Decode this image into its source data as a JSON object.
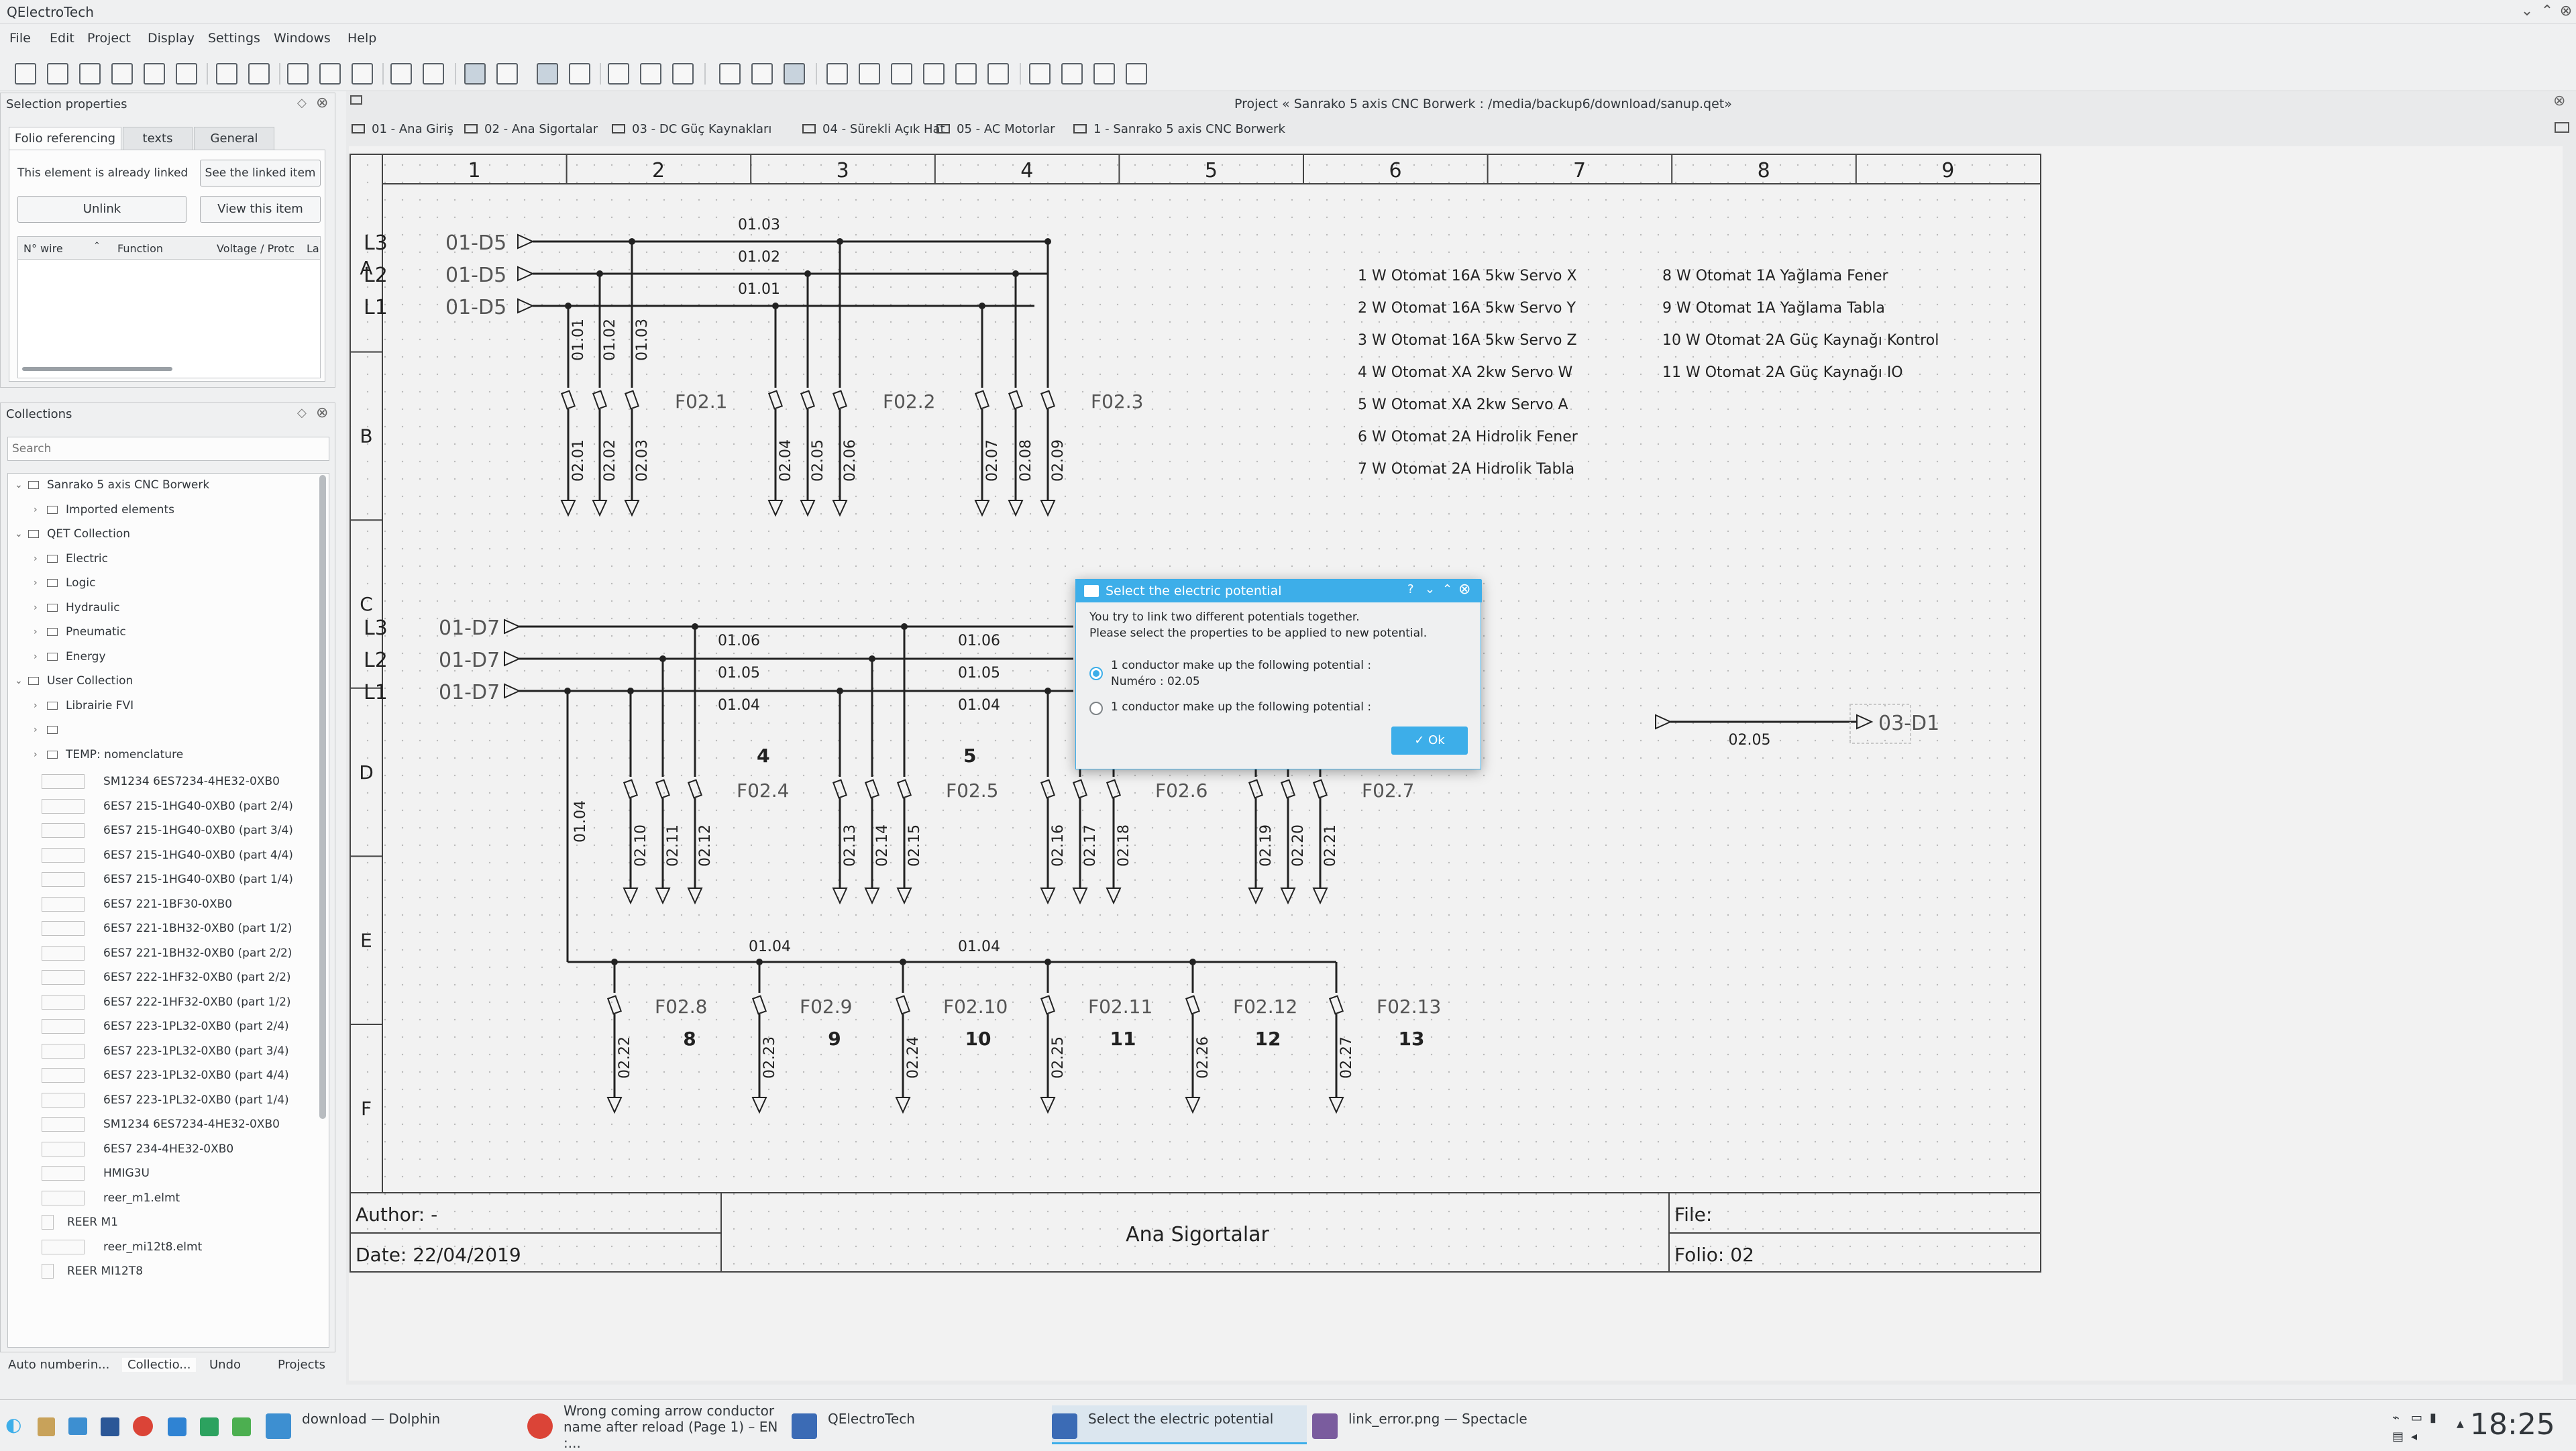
{
  "window": {
    "title": "QElectroTech"
  },
  "menu": [
    "File",
    "Edit",
    "Project",
    "Display",
    "Settings",
    "Windows",
    "Help"
  ],
  "selection_properties": {
    "title": "Selection properties",
    "tabs": [
      "Folio referencing",
      "texts",
      "General"
    ],
    "linked_msg": "This element is already linked",
    "see_linked": "See the linked item",
    "unlink": "Unlink",
    "view_item": "View this item",
    "columns": [
      "N° wire",
      "Function",
      "Voltage / Protc",
      "La"
    ]
  },
  "collections": {
    "title": "Collections",
    "search_placeholder": "Search",
    "tree": [
      {
        "label": "Sanrako 5 axis CNC Borwerk",
        "level": 0,
        "expanded": true
      },
      {
        "label": "Imported elements",
        "level": 1
      },
      {
        "label": "QET Collection",
        "level": 0,
        "expanded": true
      },
      {
        "label": "Electric",
        "level": 1
      },
      {
        "label": "Logic",
        "level": 1
      },
      {
        "label": "Hydraulic",
        "level": 1
      },
      {
        "label": "Pneumatic",
        "level": 1
      },
      {
        "label": "Energy",
        "level": 1
      },
      {
        "label": "User Collection",
        "level": 0,
        "expanded": true
      },
      {
        "label": "Librairie FVI",
        "level": 1
      },
      {
        "label": "",
        "level": 1
      },
      {
        "label": "TEMP: nomenclature",
        "level": 1
      }
    ],
    "items": [
      "SM1234 6ES7234-4HE32-0XB0",
      "6ES7 215-1HG40-0XB0 (part 2/4)",
      "6ES7 215-1HG40-0XB0 (part 3/4)",
      "6ES7 215-1HG40-0XB0 (part 4/4)",
      "6ES7 215-1HG40-0XB0 (part 1/4)",
      "6ES7 221-1BF30-0XB0",
      "6ES7 221-1BH32-0XB0 (part 1/2)",
      "6ES7 221-1BH32-0XB0 (part 2/2)",
      "6ES7 222-1HF32-0XB0 (part 2/2)",
      "6ES7 222-1HF32-0XB0 (part 1/2)",
      "6ES7 223-1PL32-0XB0 (part 2/4)",
      "6ES7 223-1PL32-0XB0 (part 3/4)",
      "6ES7 223-1PL32-0XB0 (part 4/4)",
      "6ES7 223-1PL32-0XB0 (part 1/4)",
      "SM1234 6ES7234-4HE32-0XB0",
      "6ES7 234-4HE32-0XB0",
      "HMIG3U",
      "reer_m1.elmt",
      "REER M1",
      "reer_mi12t8.elmt",
      "REER MI12T8"
    ]
  },
  "bottom_tabs": [
    "Auto numberin...",
    "Collectio...",
    "Undo",
    "Projects"
  ],
  "project_title": "Project « Sanrako 5 axis CNC Borwerk : /media/backup6/download/sanup.qet»",
  "folio_tabs": [
    "01 - Ana Giriş",
    "02 - Ana Sigortalar",
    "03 - DC Güç Kaynakları",
    "04 - Sürekli Açık Hat",
    "05 - AC Motorlar",
    "1 - Sanrako 5 axis CNC Borwerk"
  ],
  "schematic": {
    "columns": [
      "1",
      "2",
      "3",
      "4",
      "5",
      "6",
      "7",
      "8",
      "9"
    ],
    "rows": [
      "A",
      "B",
      "C",
      "D",
      "E",
      "F"
    ],
    "phases_top": [
      "L3",
      "L2",
      "L1"
    ],
    "phase_ref_top": "01-D5",
    "bus_top": [
      "01.03",
      "01.02",
      "01.01"
    ],
    "vertical_top": [
      "01.01",
      "01.02",
      "01.03"
    ],
    "fuses_top": [
      "F02.1",
      "F02.2",
      "F02.3"
    ],
    "wires_top": [
      "02.01",
      "02.02",
      "02.03",
      "02.04",
      "02.05",
      "02.06",
      "02.07",
      "02.08",
      "02.09"
    ],
    "phases_mid": [
      "L3",
      "L2",
      "L1"
    ],
    "phase_ref_mid": "01-D7",
    "bus_mid": [
      "01.06",
      "01.05",
      "01.04"
    ],
    "bus_mid2": [
      "01.06",
      "01.05",
      "01.04"
    ],
    "mid_numbers": [
      "4",
      "5"
    ],
    "fuses_mid": [
      "F02.4",
      "F02.5",
      "F02.6",
      "F02.7"
    ],
    "wires_mid": [
      "02.10",
      "02.11",
      "02.12",
      "02.13",
      "02.14",
      "02.15",
      "02.16",
      "02.17",
      "02.18",
      "02.19",
      "02.20",
      "02.21"
    ],
    "v_left": "01.04",
    "bus_bottom": [
      "01.04",
      "01.04"
    ],
    "fuses_bottom": [
      "F02.8",
      "F02.9",
      "F02.10",
      "F02.11",
      "F02.12",
      "F02.13"
    ],
    "numbers_bottom": [
      "8",
      "9",
      "10",
      "11",
      "12",
      "13"
    ],
    "wires_bottom": [
      "02.22",
      "02.23",
      "02.24",
      "02.25",
      "02.26",
      "02.27"
    ],
    "legend_left": [
      "1  W Otomat 16A 5kw Servo X",
      "2  W Otomat 16A 5kw Servo Y",
      "3  W Otomat 16A 5kw Servo Z",
      "4  W Otomat XA 2kw Servo W",
      "5  W Otomat XA 2kw Servo A",
      "6  W Otomat 2A Hidrolik Fener",
      "7  W Otomat 2A Hidrolik Tabla"
    ],
    "legend_right": [
      "8  W Otomat 1A Yağlama Fener",
      "9  W Otomat 1A Yağlama Tabla",
      "10 W Otomat 2A Güç Kaynağı Kontrol",
      "11 W Otomat 2A Güç Kaynağı IO"
    ],
    "conductor_label": "02.05",
    "arrow_ref": "03-D1",
    "cartridge": {
      "author": "Author: -",
      "date": "Date: 22/04/2019",
      "title": "Ana Sigortalar",
      "file": "File:",
      "folio": "Folio: 02"
    }
  },
  "dialog": {
    "title": "Select the electric potential",
    "line1": "You try to link two different potentials together.",
    "line2": "Please select the properties to be applied to new potential.",
    "opt1": "1 conductor make up the following potential :",
    "opt1_sub": "Numéro : 02.05",
    "opt2": "1 conductor make up the following potential :",
    "ok": "Ok"
  },
  "taskbar": {
    "tasks": [
      {
        "label": "download — Dolphin",
        "color": "#3d8fd1"
      },
      {
        "label": "Wrong coming arrow conductor\nname after reload (Page 1) – EN :...",
        "color": "#db4437"
      },
      {
        "label": "QElectroTech",
        "color": "#3b6bb5"
      },
      {
        "label": "Select the electric potential",
        "color": "#3daee9"
      },
      {
        "label": "link_error.png — Spectacle",
        "color": "#7a5c9e"
      }
    ],
    "clock": "18:25"
  }
}
